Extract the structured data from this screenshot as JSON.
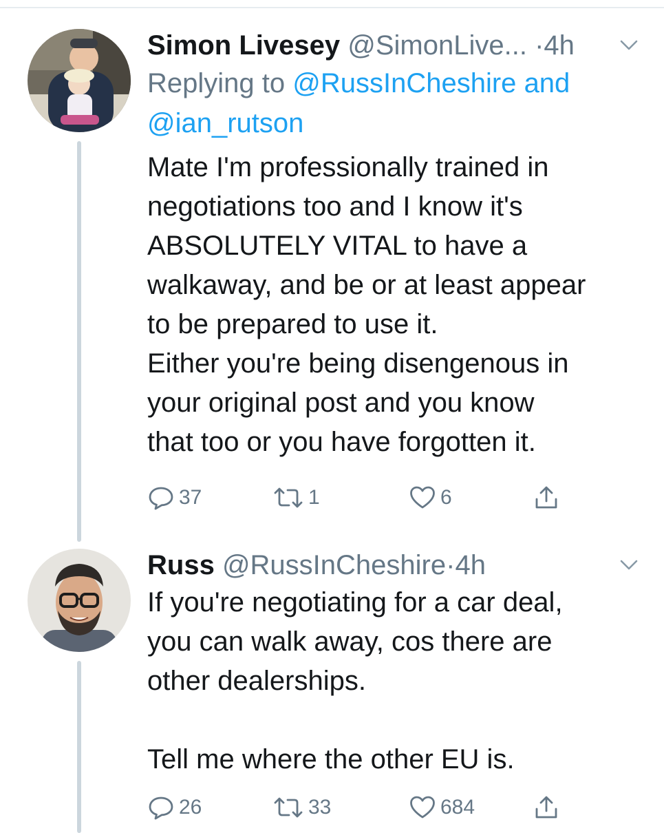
{
  "tweets": [
    {
      "display_name": "Simon Livesey",
      "handle": "@SimonLive...",
      "time": "4h",
      "reply_prefix": "Replying to",
      "reply_mention_1": "@RussInCheshire",
      "reply_join": "and",
      "reply_mention_2": "@ian_rutson",
      "text": "Mate I'm professionally trained in\nnegotiations too and I know it's\nABSOLUTELY VITAL to  have a\nwalkaway, and be or at least appear\nto be prepared to use it.\nEither you're being disengenous in\nyour original post and you know\nthat too or you have forgotten it.",
      "replies": "37",
      "retweets": "1",
      "likes": "6"
    },
    {
      "display_name": "Russ",
      "handle": "@RussInCheshire",
      "time": "4h",
      "text": "If you're negotiating for a car deal,\nyou can walk away, cos there are\nother dealerships.\n\nTell me where the other EU is.",
      "replies": "26",
      "retweets": "33",
      "likes": "684"
    }
  ],
  "icons": {
    "reply": "reply-icon",
    "retweet": "retweet-icon",
    "like": "heart-icon",
    "share": "share-icon",
    "menu": "chevron-down-icon"
  },
  "colors": {
    "text": "#14171a",
    "muted": "#657786",
    "link": "#1da1f2",
    "thread_line": "#ccd6dd"
  },
  "separator": "·"
}
